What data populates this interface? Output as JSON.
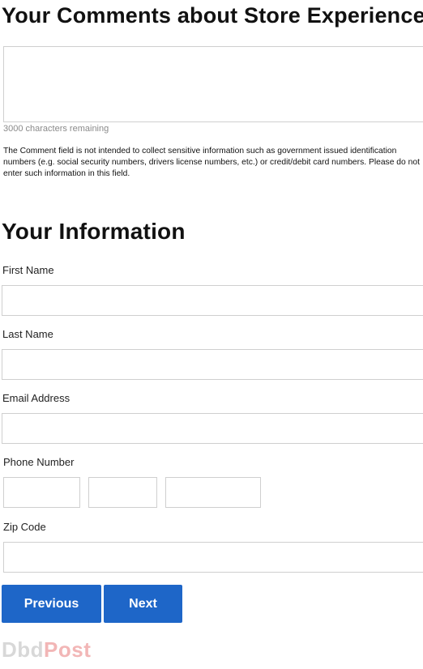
{
  "comments_section": {
    "title": "Your Comments about Store Experience",
    "chars_remaining": "3000 characters remaining",
    "disclaimer": "The Comment field is not intended to collect sensitive information such as government issued identification numbers (e.g. social security numbers, drivers license numbers, etc.) or credit/debit card numbers. Please do not enter such information in this field.",
    "comment_value": ""
  },
  "info_section": {
    "title": "Your Information",
    "first_name_label": "First Name",
    "first_name_value": "",
    "last_name_label": "Last Name",
    "last_name_value": "",
    "email_label": "Email Address",
    "email_value": "",
    "phone_label": "Phone Number",
    "phone_area_value": "",
    "phone_prefix_value": "",
    "phone_line_value": "",
    "zip_label": "Zip Code",
    "zip_value": ""
  },
  "buttons": {
    "previous_label": "Previous",
    "next_label": "Next"
  },
  "watermark": {
    "part1": "Dbd",
    "part2": "Post"
  },
  "colors": {
    "button_bg": "#1e66c8",
    "input_border": "#cfcfcf"
  }
}
